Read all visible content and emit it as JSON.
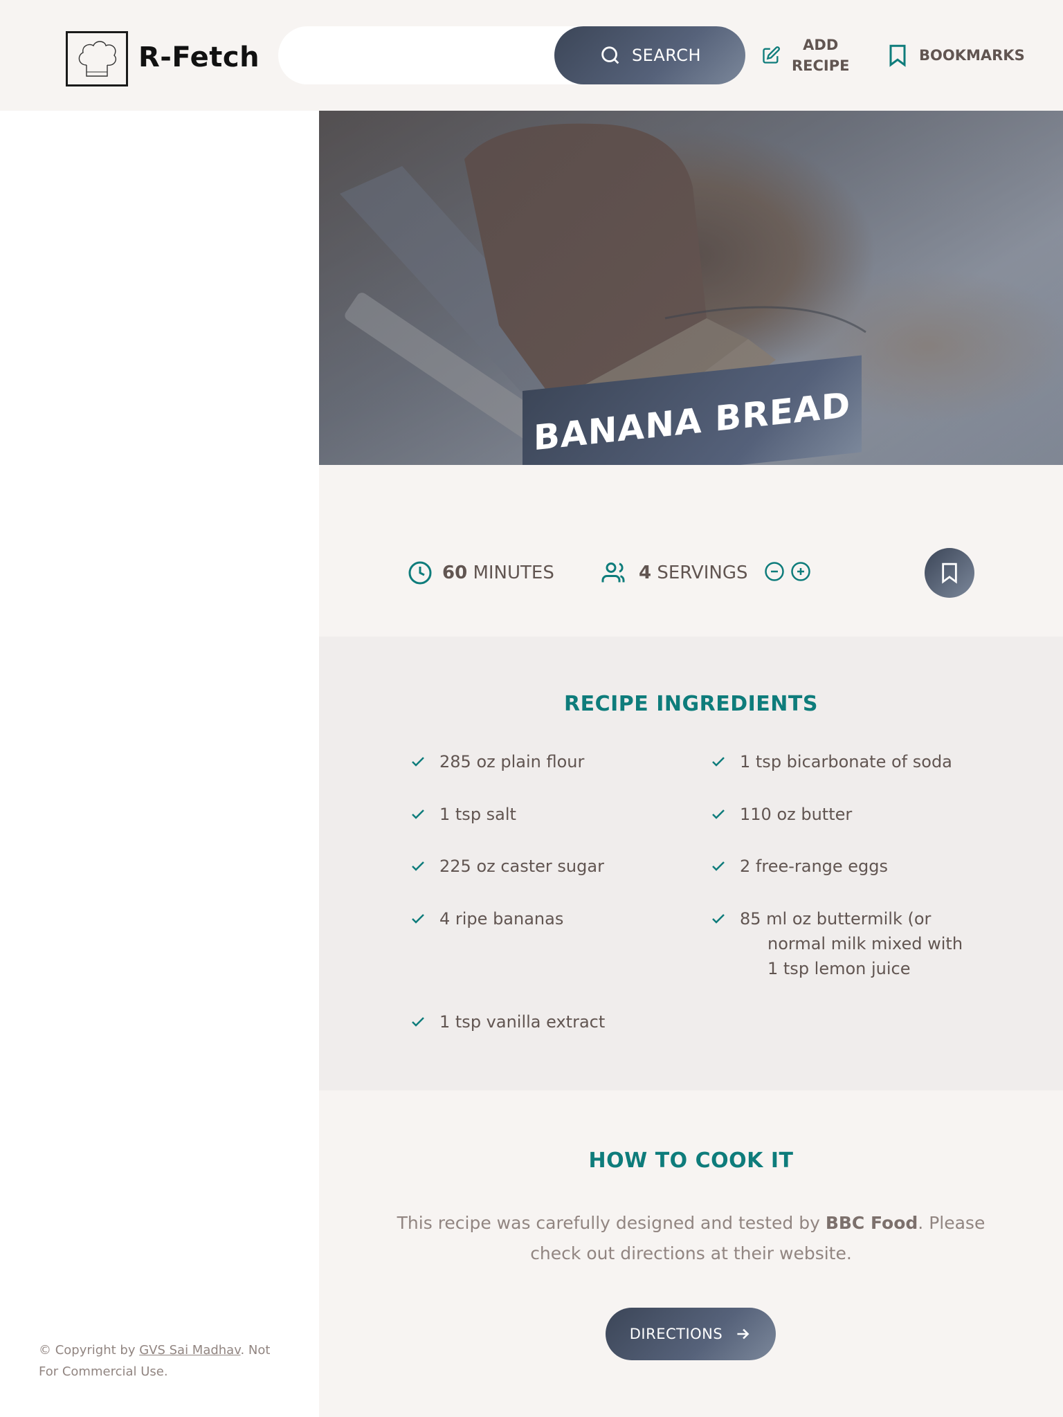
{
  "header": {
    "brand": "R-Fetch",
    "search": {
      "value": "",
      "placeholder": "",
      "button_label": "SEARCH"
    },
    "nav": {
      "add_recipe_line1": "ADD",
      "add_recipe_line2": "RECIPE",
      "bookmarks": "BOOKMARKS"
    }
  },
  "recipe": {
    "title": "BANANA BREAD",
    "cooking_time": "60",
    "cooking_unit": "MINUTES",
    "servings": "4",
    "servings_unit": "SERVINGS",
    "ingredients_title": "RECIPE INGREDIENTS",
    "ingredients": [
      "285 oz plain flour",
      "1 tsp bicarbonate of soda",
      "1 tsp salt",
      "110 oz butter",
      "225 oz caster sugar",
      "2 free-range eggs",
      "4 ripe bananas",
      "85 ml oz buttermilk (or normal milk mixed with 1 tsp lemon juice",
      "1 tsp vanilla extract"
    ],
    "cook_title": "HOW TO COOK IT",
    "cook_text_1": "This recipe was carefully designed and tested by ",
    "publisher": "BBC Food",
    "cook_text_2": ". Please check out directions at their website.",
    "directions_label": "DIRECTIONS"
  },
  "footer": {
    "copyright_prefix": "© Copyright by ",
    "author": "GVS Sai Madhav",
    "copyright_suffix": ". Not For Commercial Use."
  },
  "colors": {
    "accent": "#0e7c7b",
    "button_dark": "#3c4658",
    "text": "#615551",
    "muted": "#918581"
  },
  "icons": [
    "chef-hat-icon",
    "search-icon",
    "edit-icon",
    "bookmark-icon",
    "clock-icon",
    "users-icon",
    "minus-circle-icon",
    "plus-circle-icon",
    "check-icon",
    "arrow-right-icon"
  ]
}
